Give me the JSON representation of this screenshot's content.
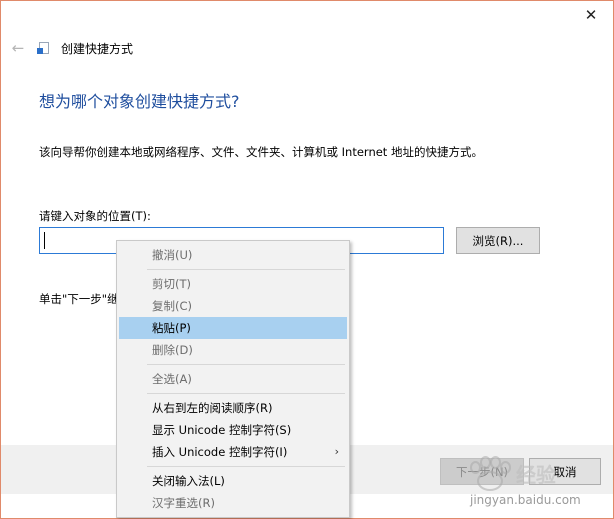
{
  "window": {
    "close_glyph": "✕"
  },
  "header": {
    "title": "创建快捷方式"
  },
  "wizard": {
    "heading": "想为哪个对象创建快捷方式?",
    "description": "该向导帮你创建本地或网络程序、文件、文件夹、计算机或 Internet 地址的快捷方式。",
    "location_label": "请键入对象的位置(T):",
    "location_value": "",
    "browse_label": "浏览(R)...",
    "hint_text": "单击\"下一步\"继"
  },
  "footer": {
    "next_label": "下一步(N)",
    "cancel_label": "取消"
  },
  "context_menu": {
    "undo": "撤消(U)",
    "cut": "剪切(T)",
    "copy": "复制(C)",
    "paste": "粘贴(P)",
    "delete": "删除(D)",
    "select_all": "全选(A)",
    "rtl_order": "从右到左的阅读顺序(R)",
    "show_unicode": "显示 Unicode 控制字符(S)",
    "insert_unicode": "插入 Unicode 控制字符(I)",
    "close_ime": "关闭输入法(L)",
    "reconvert": "汉字重选(R)",
    "highlight_color": "#a8d0f0"
  },
  "watermark": {
    "brand": "经验",
    "url": "jingyan.baidu.com"
  }
}
